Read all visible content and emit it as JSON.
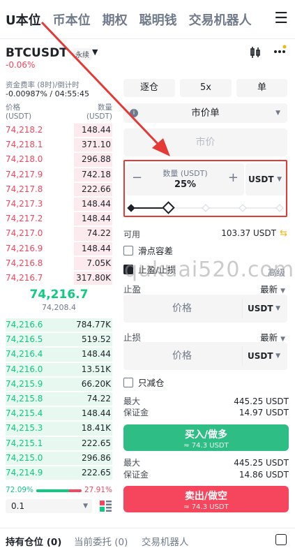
{
  "top_tabs": [
    "U本位",
    "币本位",
    "期权",
    "聪明钱",
    "交易机器人"
  ],
  "menu_icon": "hamburger-icon",
  "symbol": "BTCUSDT",
  "contract_type": "永续",
  "change": "-0.06%",
  "funding_label": "资金费率 (8时)/倒计时",
  "funding_value": "-0.00987% / 04:55:45",
  "orderbook": {
    "price_header": "价格\n(USDT)",
    "qty_header": "数量\n(USDT)",
    "asks": [
      {
        "price": "74,218.2",
        "qty": "148.44",
        "depth": 0.36
      },
      {
        "price": "74,218.1",
        "qty": "371.10",
        "depth": 0.36
      },
      {
        "price": "74,218.0",
        "qty": "296.88",
        "depth": 0.36
      },
      {
        "price": "74,217.9",
        "qty": "742.18",
        "depth": 0.36
      },
      {
        "price": "74,217.8",
        "qty": "222.66",
        "depth": 0.36
      },
      {
        "price": "74,217.3",
        "qty": "148.44",
        "depth": 0.36
      },
      {
        "price": "74,217.2",
        "qty": "148.44",
        "depth": 0.36
      },
      {
        "price": "74,217.0",
        "qty": "74.22",
        "depth": 0.36
      },
      {
        "price": "74,216.9",
        "qty": "148.44",
        "depth": 0.36
      },
      {
        "price": "74,216.8",
        "qty": "7.05K",
        "depth": 0.36
      },
      {
        "price": "74,216.7",
        "qty": "317.80K",
        "depth": 0.36
      }
    ],
    "last_price": "74,216.7",
    "mark_price": "74,208.4",
    "bids": [
      {
        "price": "74,216.6",
        "qty": "784.77K",
        "depth": 1.0
      },
      {
        "price": "74,216.5",
        "qty": "519.52",
        "depth": 1.0
      },
      {
        "price": "74,216.4",
        "qty": "148.44",
        "depth": 1.0
      },
      {
        "price": "74,216.0",
        "qty": "13.51K",
        "depth": 1.0
      },
      {
        "price": "74,215.9",
        "qty": "66.20K",
        "depth": 1.0
      },
      {
        "price": "74,215.8",
        "qty": "74.22",
        "depth": 1.0
      },
      {
        "price": "74,215.4",
        "qty": "148.44",
        "depth": 1.0
      },
      {
        "price": "74,215.3",
        "qty": "18.41K",
        "depth": 1.0
      },
      {
        "price": "74,215.1",
        "qty": "222.65",
        "depth": 1.0
      },
      {
        "price": "74,215.0",
        "qty": "296.86",
        "depth": 1.0
      },
      {
        "price": "74,214.9",
        "qty": "222.65",
        "depth": 1.0
      }
    ],
    "buy_ratio": "72.09%",
    "sell_ratio": "27.91%",
    "buy_ratio_value": 0.7209,
    "precision": "0.1"
  },
  "order": {
    "margin_mode": "逐仓",
    "leverage": "5x",
    "position_mode": "单",
    "order_type": "市价单",
    "price_placeholder": "市价",
    "qty_label": "数量 (USDT)",
    "qty_value": "25%",
    "qty_unit": "USDT",
    "slider_value": 0.25,
    "available_label": "可用",
    "available_value": "103.37 USDT",
    "slippage_label": "滑点容差",
    "tpsl_label": "止盈/止损",
    "tpsl_adv": "高级",
    "tp_label": "止盈",
    "tp_trigger": "最新",
    "tp_price_placeholder": "价格",
    "tp_unit": "USDT",
    "sl_label": "止损",
    "sl_trigger": "最新",
    "sl_price_placeholder": "价格",
    "sl_unit": "USDT",
    "reduce_only_label": "只减仓",
    "buy_max_label": "最大",
    "buy_max_value": "445.25 USDT",
    "buy_margin_label": "保证金",
    "buy_margin_value": "14.97 USDT",
    "buy_button": "买入/做多",
    "buy_sub": "≈ 74.3 USDT",
    "sell_max_label": "最大",
    "sell_max_value": "445.25 USDT",
    "sell_margin_label": "保证金",
    "sell_margin_value": "14.86 USDT",
    "sell_button": "卖出/做空",
    "sell_sub": "≈ 74.3 USDT"
  },
  "bottom_tabs": [
    "持有仓位 (0)",
    "当前委托 (0)",
    "交易机器人"
  ],
  "watermark": "qukuai520.com",
  "colors": {
    "up": "#0ecb81",
    "down": "#f6465d",
    "annotation": "#e53935"
  }
}
